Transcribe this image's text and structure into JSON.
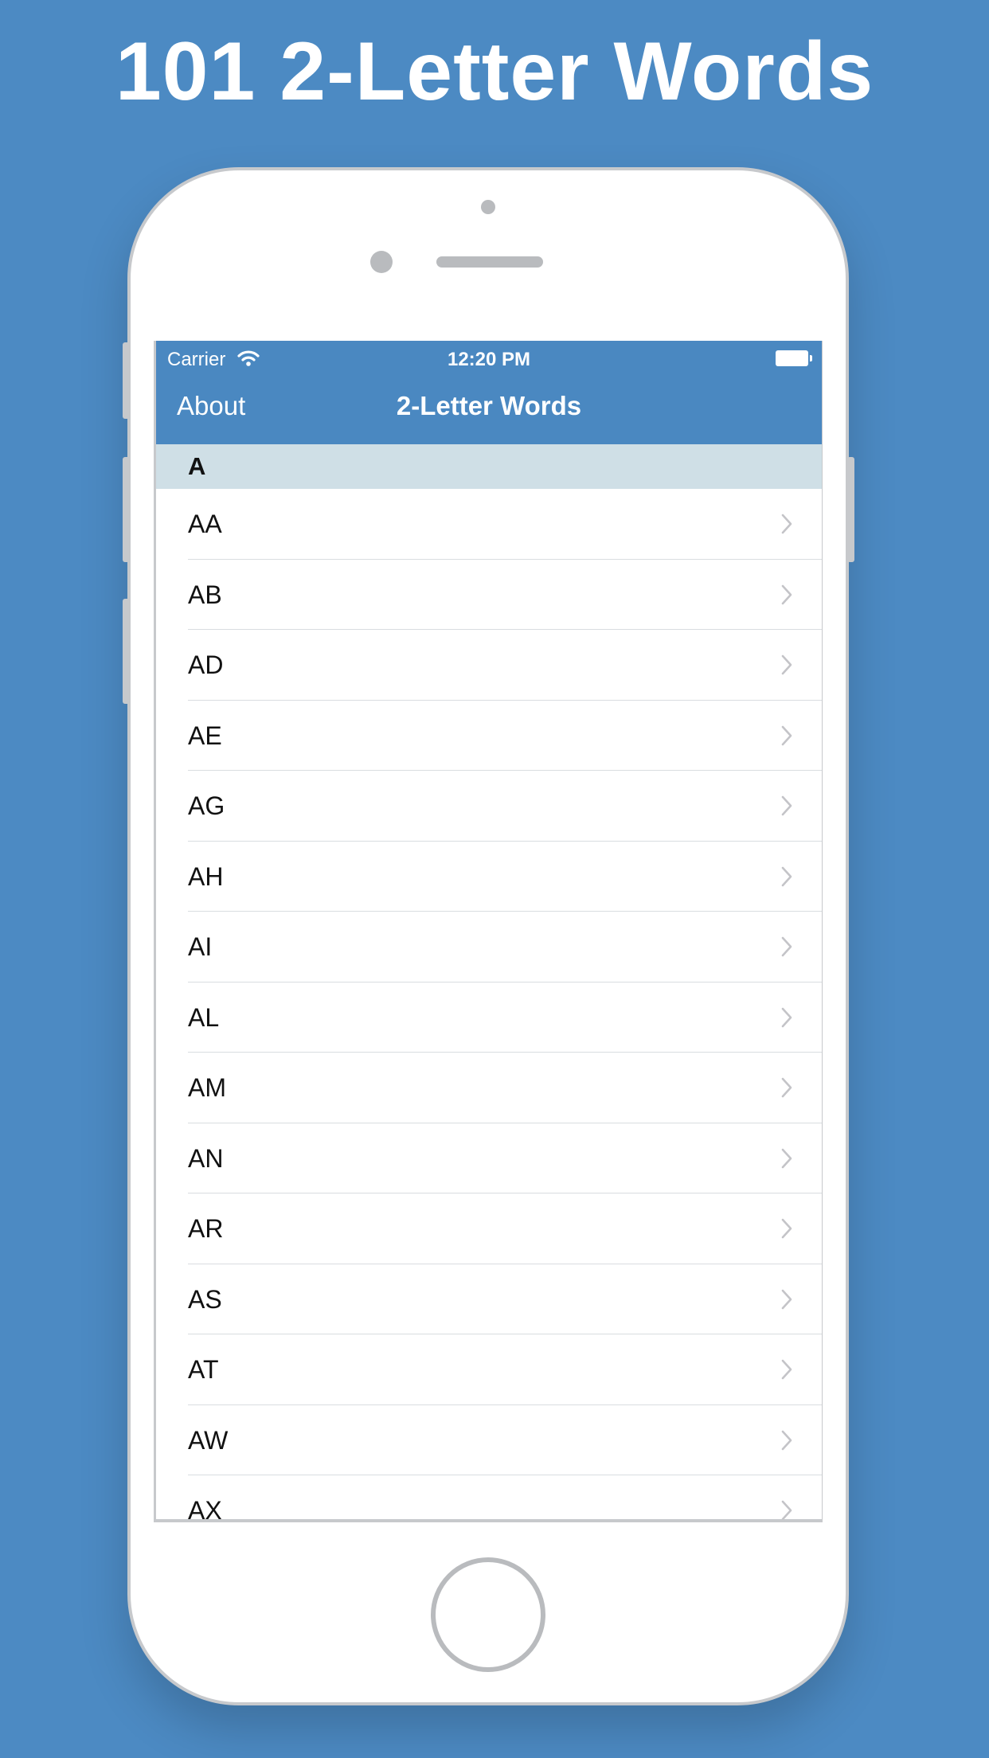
{
  "headline": "101 2-Letter Words",
  "status_bar": {
    "carrier": "Carrier",
    "time": "12:20 PM"
  },
  "navbar": {
    "left_button": "About",
    "title": "2-Letter Words"
  },
  "section": {
    "letter": "A"
  },
  "words": [
    {
      "label": "AA"
    },
    {
      "label": "AB"
    },
    {
      "label": "AD"
    },
    {
      "label": "AE"
    },
    {
      "label": "AG"
    },
    {
      "label": "AH"
    },
    {
      "label": "AI"
    },
    {
      "label": "AL"
    },
    {
      "label": "AM"
    },
    {
      "label": "AN"
    },
    {
      "label": "AR"
    },
    {
      "label": "AS"
    },
    {
      "label": "AT"
    },
    {
      "label": "AW"
    },
    {
      "label": "AX"
    }
  ],
  "colors": {
    "background": "#4c8ac3",
    "navbar": "#4a88c1",
    "section_header": "#cfdfe6",
    "separator": "#d9dde0",
    "chevron": "#c4c4c8"
  },
  "icons": {
    "row_accessory": "chevron-right-icon",
    "status_wifi": "wifi-icon",
    "status_battery": "battery-icon"
  }
}
